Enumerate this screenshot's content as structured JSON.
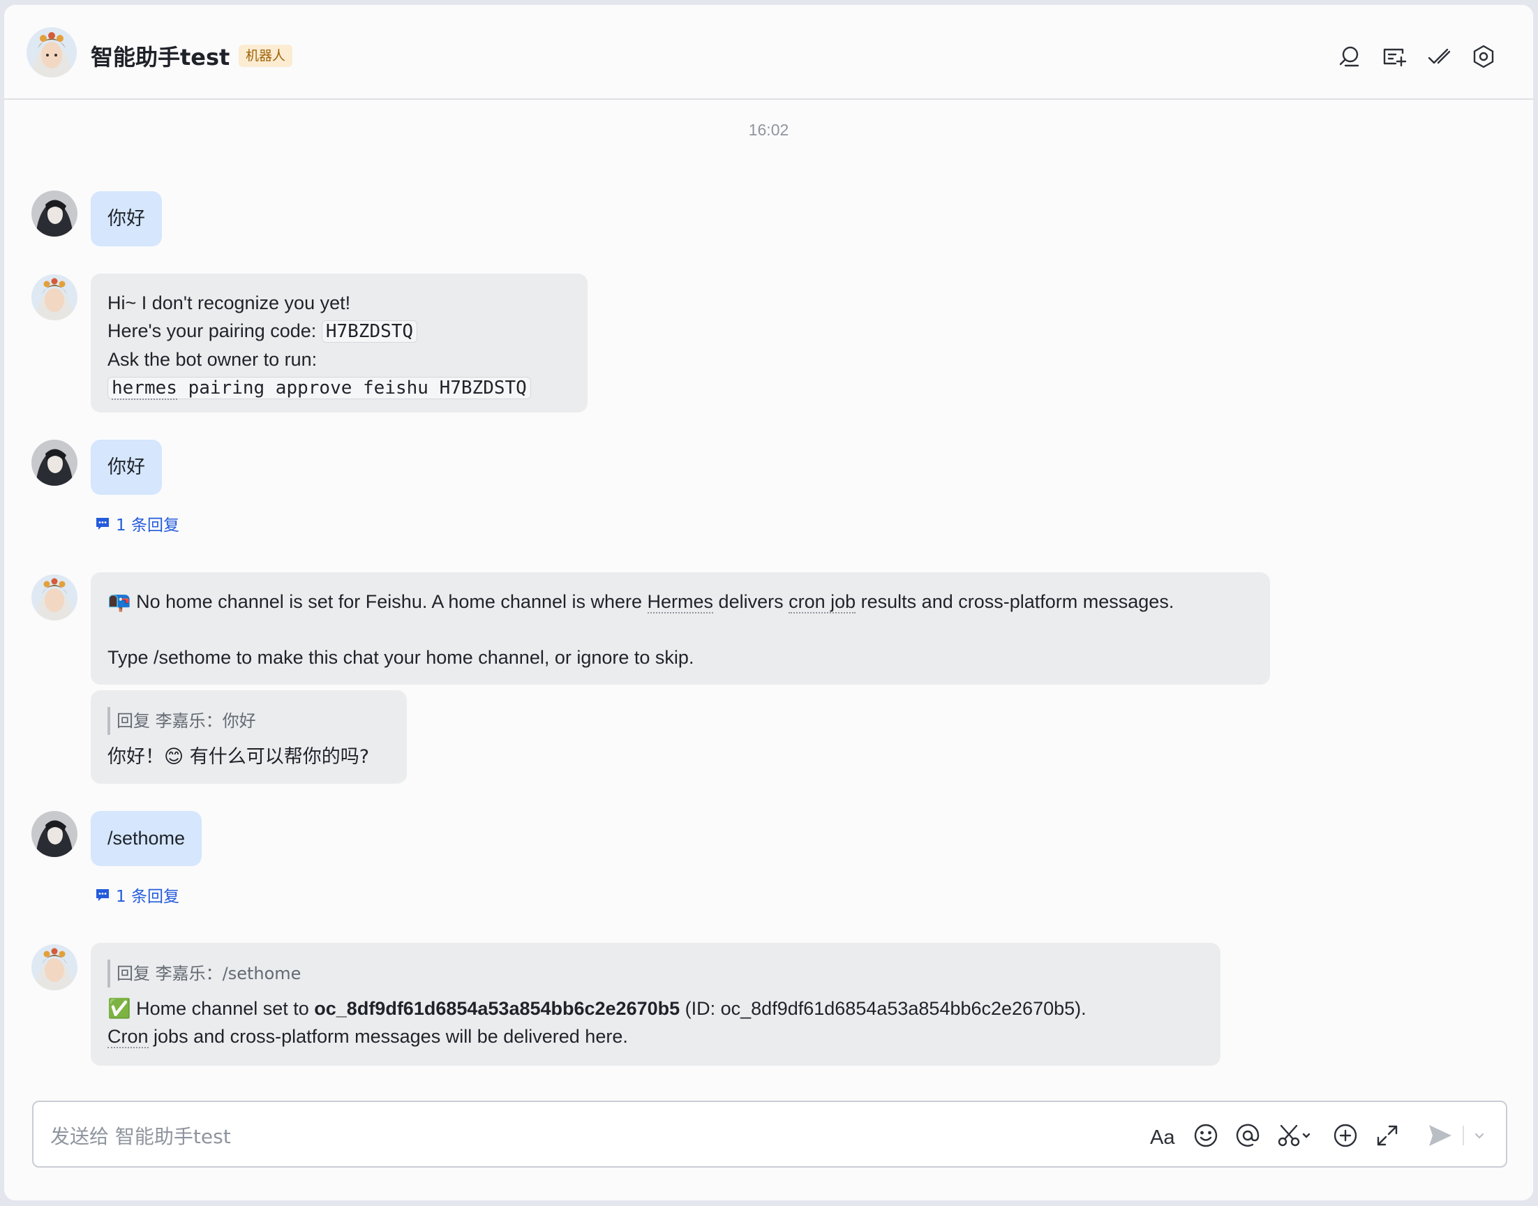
{
  "header": {
    "title": "智能助手test",
    "badge": "机器人"
  },
  "timestamp": "16:02",
  "messages": {
    "m1": {
      "text": "你好"
    },
    "m2": {
      "line1": "Hi~ I don't recognize you yet!",
      "line2_prefix": "Here's your pairing code:",
      "pairing_code": "H7BZDSTQ",
      "line3": "Ask the bot owner to run:",
      "command_first": "hermes",
      "command_rest": " pairing approve feishu H7BZDSTQ"
    },
    "m3": {
      "text": "你好",
      "reply_count": "1 条回复"
    },
    "m4": {
      "emoji": "📭",
      "p1_a": " No home channel is set for Feishu. A home channel is where ",
      "p1_hermes": "Hermes",
      "p1_b": " delivers ",
      "p1_cron": "cron job",
      "p1_c": " results and cross-platform messages.",
      "p2": "Type /sethome to make this chat your home channel, or ignore to skip."
    },
    "m5": {
      "quote": "回复 李嘉乐：你好",
      "text_a": "你好！",
      "emoji": "😊",
      "text_b": " 有什么可以帮你的吗?"
    },
    "m6": {
      "text": "/sethome",
      "reply_count": "1 条回复"
    },
    "m7": {
      "quote": "回复 李嘉乐：/sethome",
      "check": "✅",
      "prefix": " Home channel set to ",
      "channel_bold": "oc_8df9df61d6854a53a854bb6c2e2670b5",
      "suffix": " (ID: oc_8df9df61d6854a53a854bb6c2e2670b5).",
      "line2_cron": "Cron",
      "line2_rest": " jobs and cross-platform messages will be delivered here."
    }
  },
  "input": {
    "placeholder": "发送给 智能助手test"
  },
  "toolbar": {
    "format_label": "Aa"
  },
  "icons": {
    "header": [
      "search-icon",
      "new-topic-icon",
      "mark-done-icon",
      "settings-icon"
    ],
    "toolbar": [
      "text-format-icon",
      "emoji-icon",
      "mention-icon",
      "screenshot-icon",
      "add-icon",
      "expand-icon",
      "send-icon",
      "send-options-icon"
    ]
  },
  "colors": {
    "self_bubble": "#d5e6fd",
    "bot_bubble": "#ebecee",
    "link_blue": "#245bdb",
    "badge_bg": "#fbecd2"
  }
}
